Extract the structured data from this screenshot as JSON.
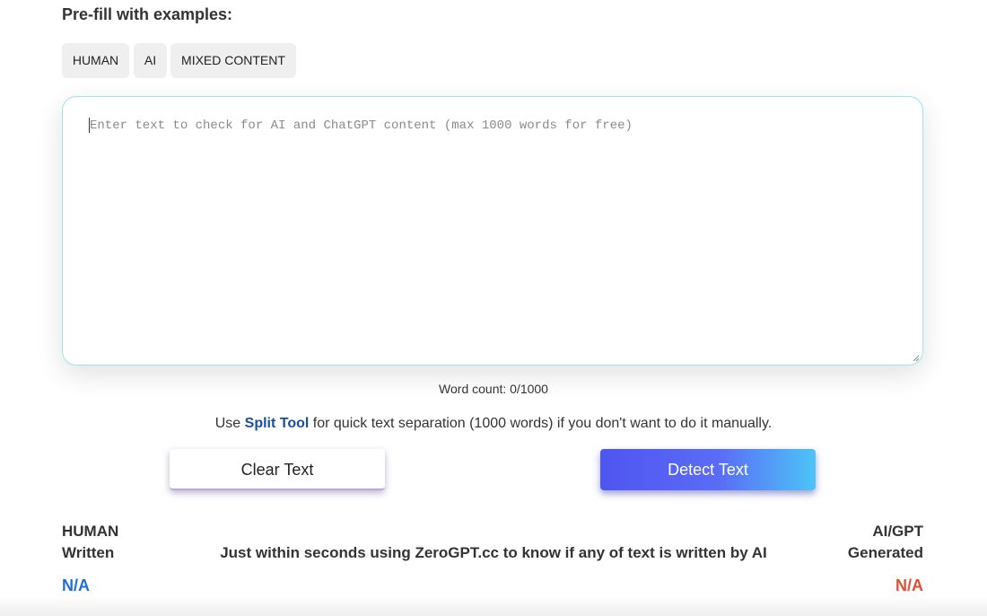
{
  "prefill": {
    "heading": "Pre-fill with examples:",
    "buttons": [
      "HUMAN",
      "AI",
      "MIXED CONTENT"
    ]
  },
  "editor": {
    "value": "",
    "placeholder": "Enter text to check for AI and ChatGPT content (max 1000 words for free)"
  },
  "word_count": "Word count: 0/1000",
  "split_tool": {
    "prefix": "Use ",
    "link": "Split Tool",
    "suffix": " for quick text separation (1000 words) if you don't want to do it manually."
  },
  "actions": {
    "clear": "Clear Text",
    "detect": "Detect Text"
  },
  "results": {
    "human_label_line1": "HUMAN",
    "human_label_line2": "Written",
    "ai_label_line1": "AI/GPT",
    "ai_label_line2": "Generated",
    "tagline": "Just within seconds using ZeroGPT.cc to know if any of text is written by AI",
    "human_value": "N/A",
    "ai_value": "N/A",
    "human_color": "#1e6fd9",
    "ai_color": "#e04e33"
  },
  "colors": {
    "accent": "#4f55f0",
    "link": "#1a4fa0",
    "input_border": "#9fe3ef"
  }
}
